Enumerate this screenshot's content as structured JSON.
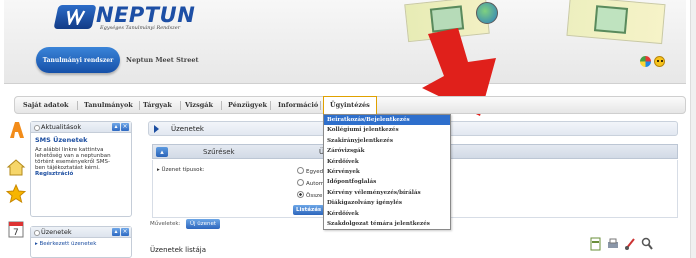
{
  "header": {
    "logo_text": "NEPTUN",
    "logo_subtitle": "Egységes Tanulmányi Rendszer",
    "system_pill": "Tanulmányi rendszer",
    "university": "Neptun Meet Street"
  },
  "menu": {
    "items": [
      "Saját adatok",
      "Tanulmányok",
      "Tárgyak",
      "Vizsgák",
      "Pénzügyek",
      "Információ",
      "Ügyintézés"
    ],
    "active": "Ügyintézés"
  },
  "dropdown": {
    "items": [
      "Beiratkozás/Bejelentkezés",
      "Kollégiumi jelentkezés",
      "Szakirányjelentkezés",
      "Záróvizsgák",
      "Kérdőívek",
      "Kérvények",
      "Időpontfoglalás",
      "Kérvény véleményezés/bírálás",
      "Diákigazolvány igénylés",
      "Kérdőívek",
      "Szakdolgozat témára jelentkezés"
    ],
    "highlighted_index": 0,
    "highlight_color": "#2e6fcc"
  },
  "sidebar": {
    "news_box": {
      "title": "Aktualitások",
      "sms_title": "SMS Üzenetek",
      "sms_text": "Az alábbi linkre kattintva lehetőség van a neptunban történt eseményekről SMS-ben tájékoztatást kérni.",
      "sms_link": "Regisztráció"
    },
    "messages_box": {
      "title": "Üzenetek",
      "first_item": "Beérkezett üzenetek"
    }
  },
  "main": {
    "title": "Üzenetek",
    "filter_label": "Szűrések",
    "filter_label2": "Ü",
    "message_type_label": "Üzenet típusok:",
    "radio_options": [
      "Egyed",
      "Autom",
      "Össze"
    ],
    "radio_checked_index": 2,
    "list_button": "Listázás",
    "operations_label": "Műveletek:",
    "new_message_button": "Új üzenet",
    "message_list_title": "Üzenetek listája"
  },
  "colors": {
    "accent_blue": "#1b4da0",
    "active_tab_border": "#e0a100",
    "arrow_red": "#e0201b"
  }
}
